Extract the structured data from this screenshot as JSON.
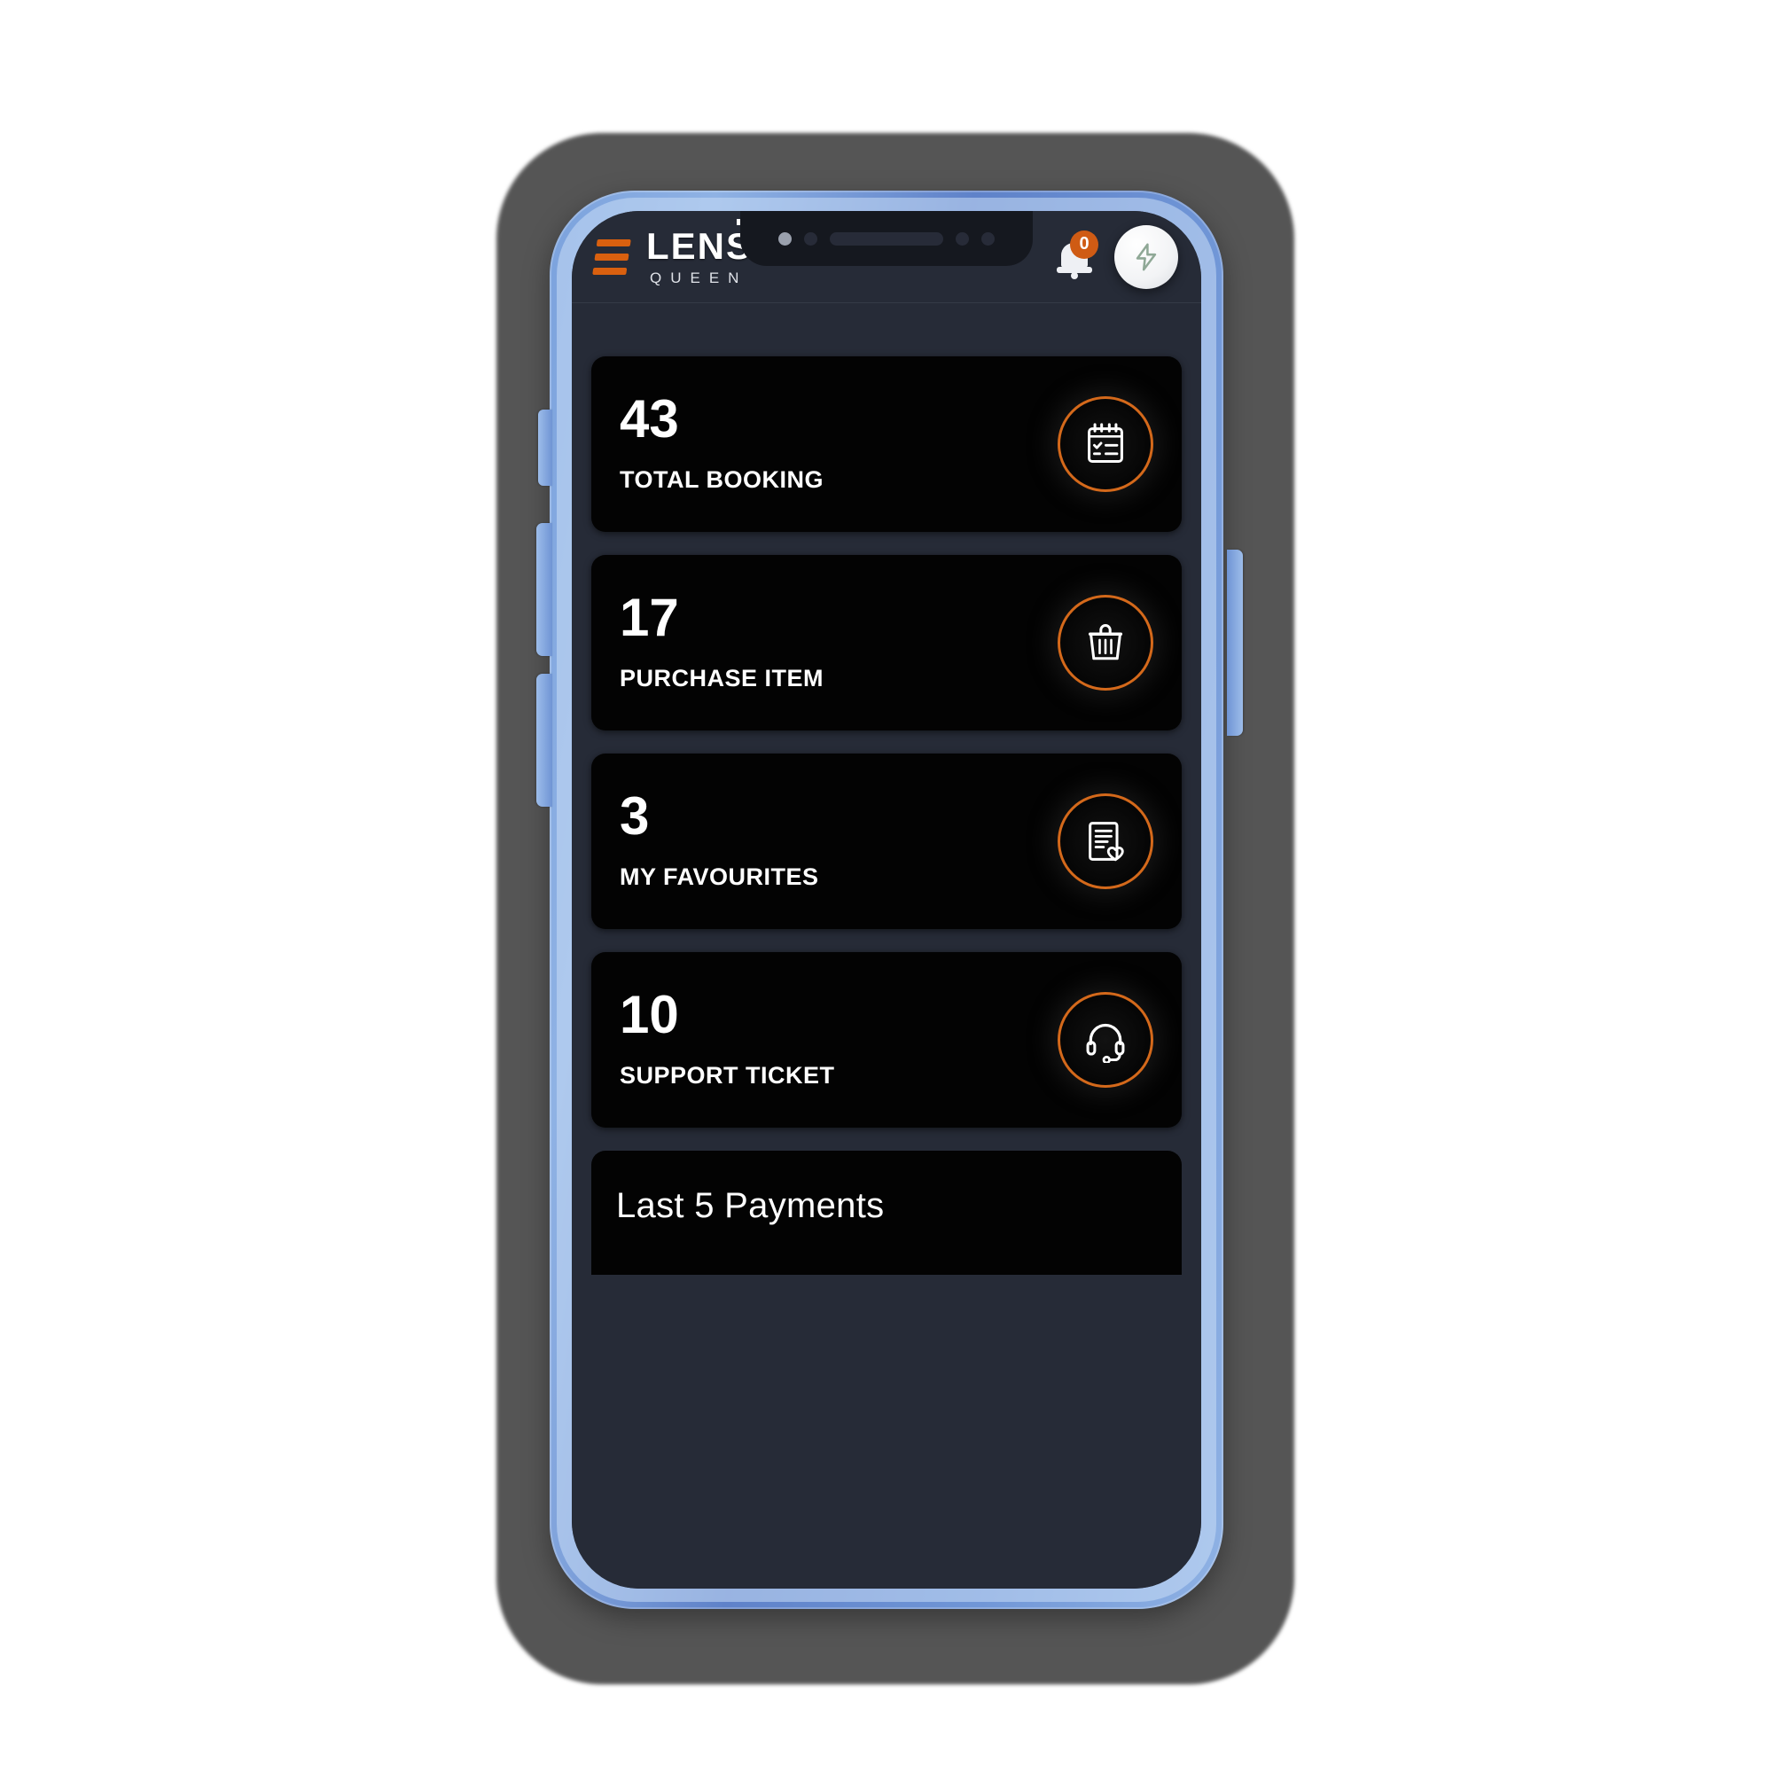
{
  "app": {
    "brand_main": "LENS",
    "brand_sub": "QUEEN",
    "menu_icon": "hamburger-menu-icon",
    "accent_color": "#d4691b",
    "screen_bg": "#262b37",
    "card_bg": "#030303",
    "frame_color": "#6f95d6"
  },
  "header": {
    "notification_badge": "0",
    "bell_icon": "bell-icon",
    "fab_icon": "lightning-bolt-icon"
  },
  "stats": [
    {
      "value": "43",
      "label": "TOTAL BOOKING",
      "icon": "clipboard-checklist-icon"
    },
    {
      "value": "17",
      "label": "PURCHASE ITEM",
      "icon": "shopping-basket-icon"
    },
    {
      "value": "3",
      "label": "MY FAVOURITES",
      "icon": "document-heart-icon"
    },
    {
      "value": "10",
      "label": "SUPPORT TICKET",
      "icon": "headset-icon"
    }
  ],
  "payments": {
    "title": "Last 5 Payments"
  }
}
